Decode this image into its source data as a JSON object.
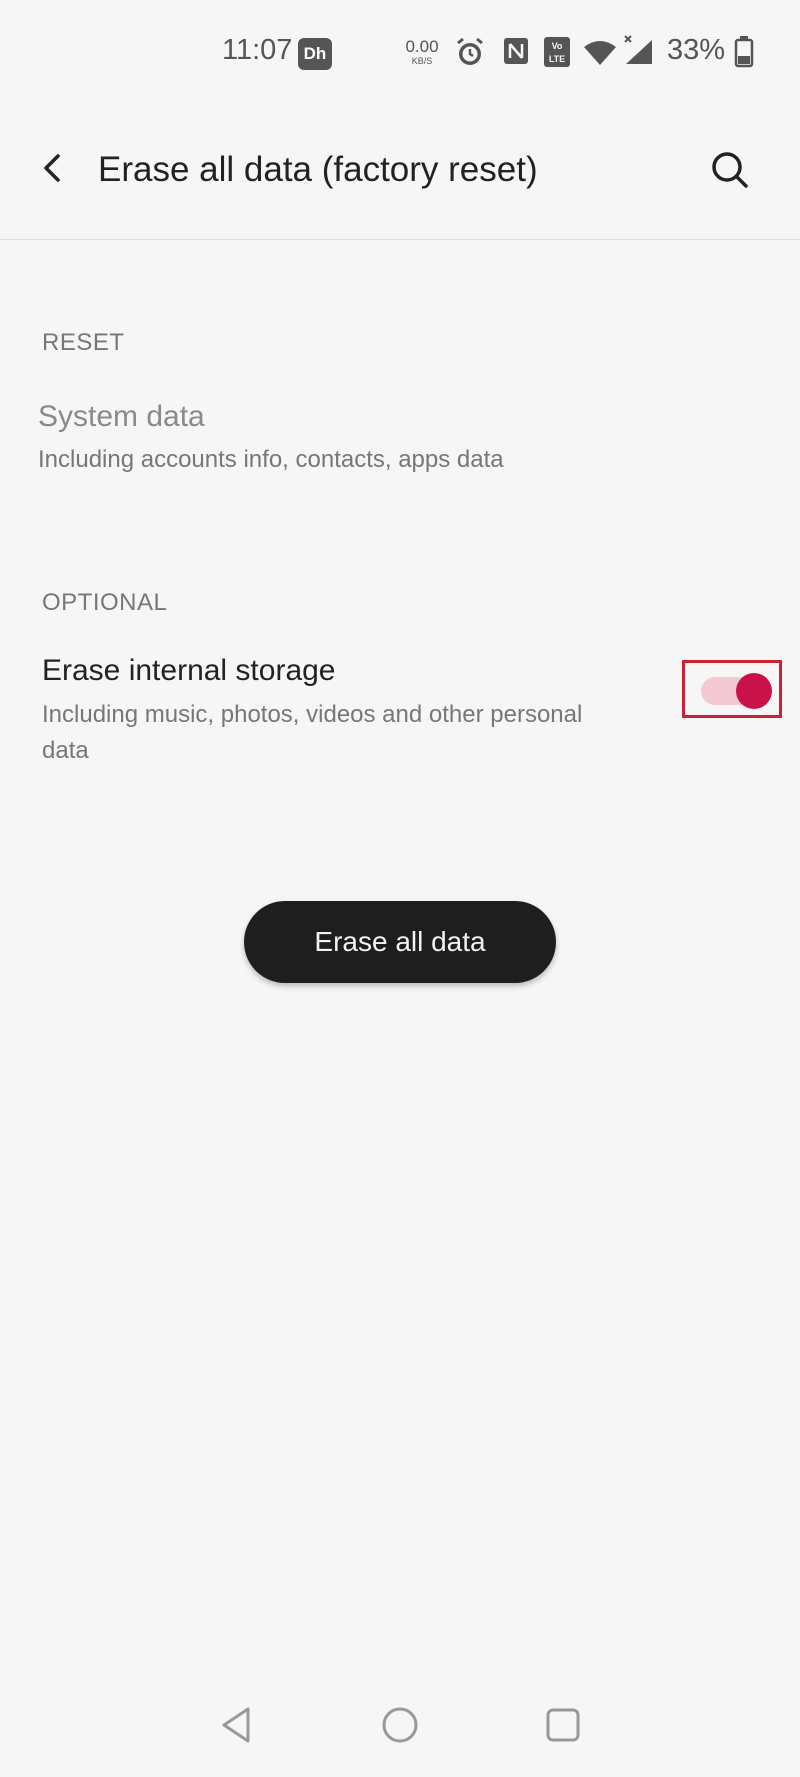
{
  "status_bar": {
    "time": "11:07",
    "dh_badge": "Dh",
    "net_speed_value": "0.00",
    "net_speed_unit": "KB/S",
    "battery_percent": "33%",
    "icons": [
      "dh-badge-icon",
      "alarm-icon",
      "nfc-icon",
      "volte-icon",
      "wifi-icon",
      "signal-icon",
      "battery-icon"
    ]
  },
  "app_bar": {
    "title": "Erase all data (factory reset)",
    "icons": [
      "back-arrow-icon",
      "search-icon"
    ]
  },
  "sections": {
    "reset": {
      "header": "RESET",
      "item_title": "System data",
      "item_summary": "Including accounts info, contacts, apps data"
    },
    "optional": {
      "header": "OPTIONAL",
      "item_title": "Erase internal storage",
      "item_summary_line1": "Including music, photos, videos and other personal",
      "item_summary_line2": "data",
      "toggle_on": true
    }
  },
  "primary_button": {
    "label": "Erase all data"
  },
  "nav_bar": {
    "icons": [
      "nav-back-icon",
      "nav-home-icon",
      "nav-recents-icon"
    ]
  },
  "colors": {
    "accent": "#c9124a",
    "accent_track": "#f2c9d3",
    "highlight_outline": "#cc2233",
    "button_bg": "#1e1e1e",
    "background": "#f6f6f6"
  }
}
